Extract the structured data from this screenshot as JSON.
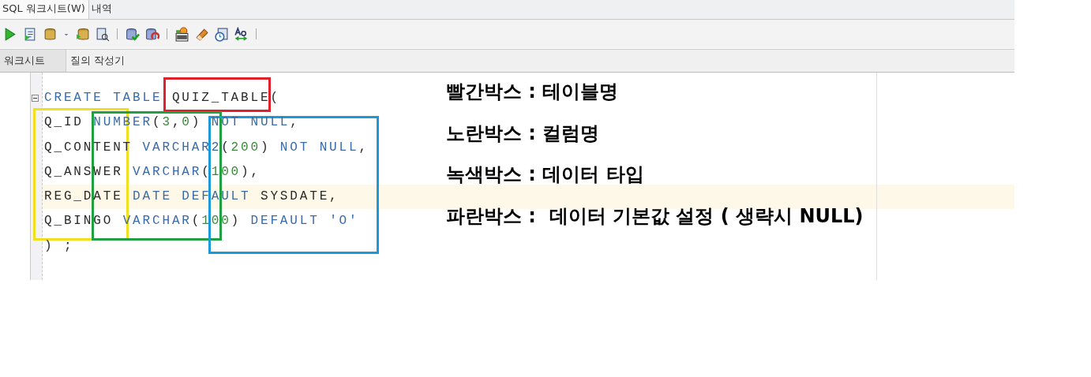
{
  "window_tabs": [
    {
      "label": "SQL 워크시트(W)",
      "selected": true
    },
    {
      "label": "내역",
      "selected": false
    }
  ],
  "editor_tabs": [
    {
      "label": "워크시트",
      "selected": true
    },
    {
      "label": "질의 작성기",
      "selected": false
    }
  ],
  "code_lines": [
    {
      "foldable": true,
      "highlighted": false,
      "tokens": [
        {
          "kind": "keyword",
          "text": "CREATE TABLE "
        },
        {
          "kind": "plain",
          "text": "QUIZ_TABLE("
        }
      ]
    },
    {
      "foldable": false,
      "highlighted": false,
      "tokens": [
        {
          "kind": "plain",
          "text": "Q_ID "
        },
        {
          "kind": "keyword",
          "text": "NUMBER"
        },
        {
          "kind": "plain",
          "text": "("
        },
        {
          "kind": "number",
          "text": "3"
        },
        {
          "kind": "plain",
          "text": ","
        },
        {
          "kind": "number",
          "text": "0"
        },
        {
          "kind": "plain",
          "text": ") "
        },
        {
          "kind": "keyword",
          "text": "NOT NULL"
        },
        {
          "kind": "plain",
          "text": ","
        }
      ]
    },
    {
      "foldable": false,
      "highlighted": false,
      "tokens": [
        {
          "kind": "plain",
          "text": "Q_CONTENT "
        },
        {
          "kind": "keyword",
          "text": "VARCHAR2"
        },
        {
          "kind": "plain",
          "text": "("
        },
        {
          "kind": "number",
          "text": "200"
        },
        {
          "kind": "plain",
          "text": ") "
        },
        {
          "kind": "keyword",
          "text": "NOT NULL"
        },
        {
          "kind": "plain",
          "text": ","
        }
      ]
    },
    {
      "foldable": false,
      "highlighted": false,
      "tokens": [
        {
          "kind": "plain",
          "text": "Q_ANSWER "
        },
        {
          "kind": "keyword",
          "text": "VARCHAR"
        },
        {
          "kind": "plain",
          "text": "("
        },
        {
          "kind": "number",
          "text": "100"
        },
        {
          "kind": "plain",
          "text": "),"
        }
      ]
    },
    {
      "foldable": false,
      "highlighted": true,
      "tokens": [
        {
          "kind": "plain",
          "text": "REG_DATE "
        },
        {
          "kind": "keyword",
          "text": "DATE DEFAULT "
        },
        {
          "kind": "plain",
          "text": "SYSDATE,"
        }
      ]
    },
    {
      "foldable": false,
      "highlighted": false,
      "tokens": [
        {
          "kind": "plain",
          "text": "Q_BINGO "
        },
        {
          "kind": "keyword",
          "text": "VARCHAR"
        },
        {
          "kind": "plain",
          "text": "("
        },
        {
          "kind": "number",
          "text": "100"
        },
        {
          "kind": "plain",
          "text": ") "
        },
        {
          "kind": "keyword",
          "text": "DEFAULT "
        },
        {
          "kind": "string",
          "text": "'O'"
        }
      ]
    },
    {
      "foldable": false,
      "highlighted": false,
      "tokens": [
        {
          "kind": "plain",
          "text": ") ;"
        }
      ]
    }
  ],
  "annotation_boxes": [
    {
      "color": "#e0202a"
    },
    {
      "color": "#f0e020"
    },
    {
      "color": "#20a040"
    },
    {
      "color": "#1a9ad8"
    }
  ],
  "legend": [
    "빨간박스 : 테이블명",
    "노란박스 : 컬럼명",
    "녹색박스 : 데이터 타입",
    "파란박스 :  데이터 기본값 설정 ( 생략시 NULL)"
  ]
}
